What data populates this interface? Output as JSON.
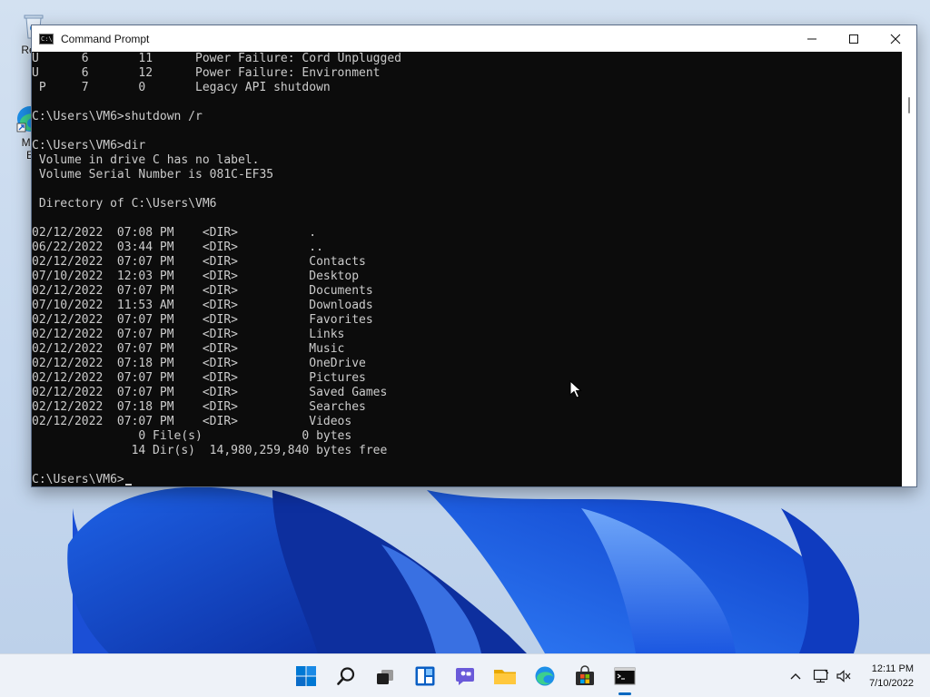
{
  "desktop": {
    "icons": [
      {
        "label": "Recy",
        "name": "recycle-bin"
      },
      {
        "label": "Mic\nE",
        "name": "microsoft-edge"
      }
    ]
  },
  "window": {
    "title": "Command Prompt",
    "icon": "cmd-icon",
    "controls": [
      "minimize-icon",
      "maximize-icon",
      "close-icon"
    ]
  },
  "console": {
    "lines": [
      "U      6       11      Power Failure: Cord Unplugged",
      "U      6       12      Power Failure: Environment",
      " P     7       0       Legacy API shutdown",
      "",
      "C:\\Users\\VM6>shutdown /r",
      "",
      "C:\\Users\\VM6>dir",
      " Volume in drive C has no label.",
      " Volume Serial Number is 081C-EF35",
      "",
      " Directory of C:\\Users\\VM6",
      "",
      "02/12/2022  07:08 PM    <DIR>          .",
      "06/22/2022  03:44 PM    <DIR>          ..",
      "02/12/2022  07:07 PM    <DIR>          Contacts",
      "07/10/2022  12:03 PM    <DIR>          Desktop",
      "02/12/2022  07:07 PM    <DIR>          Documents",
      "07/10/2022  11:53 AM    <DIR>          Downloads",
      "02/12/2022  07:07 PM    <DIR>          Favorites",
      "02/12/2022  07:07 PM    <DIR>          Links",
      "02/12/2022  07:07 PM    <DIR>          Music",
      "02/12/2022  07:18 PM    <DIR>          OneDrive",
      "02/12/2022  07:07 PM    <DIR>          Pictures",
      "02/12/2022  07:07 PM    <DIR>          Saved Games",
      "02/12/2022  07:18 PM    <DIR>          Searches",
      "02/12/2022  07:07 PM    <DIR>          Videos",
      "               0 File(s)              0 bytes",
      "              14 Dir(s)  14,980,259,840 bytes free",
      ""
    ],
    "prompt": "C:\\Users\\VM6>"
  },
  "taskbar": {
    "items": [
      {
        "name": "start-button",
        "icon": "windows-logo-icon"
      },
      {
        "name": "search-button",
        "icon": "search-icon"
      },
      {
        "name": "task-view-button",
        "icon": "task-view-icon"
      },
      {
        "name": "widgets-button",
        "icon": "widgets-icon"
      },
      {
        "name": "chat-button",
        "icon": "chat-icon"
      },
      {
        "name": "file-explorer-button",
        "icon": "folder-icon"
      },
      {
        "name": "edge-button",
        "icon": "edge-icon"
      },
      {
        "name": "store-button",
        "icon": "store-icon"
      },
      {
        "name": "command-prompt-taskbar-button",
        "icon": "cmd-icon",
        "active": true
      }
    ],
    "tray": [
      "chevron-up-icon",
      "network-icon",
      "volume-mute-icon"
    ],
    "clock": {
      "time": "12:11 PM",
      "date": "7/10/2022"
    },
    "accent": "#0067c0"
  }
}
